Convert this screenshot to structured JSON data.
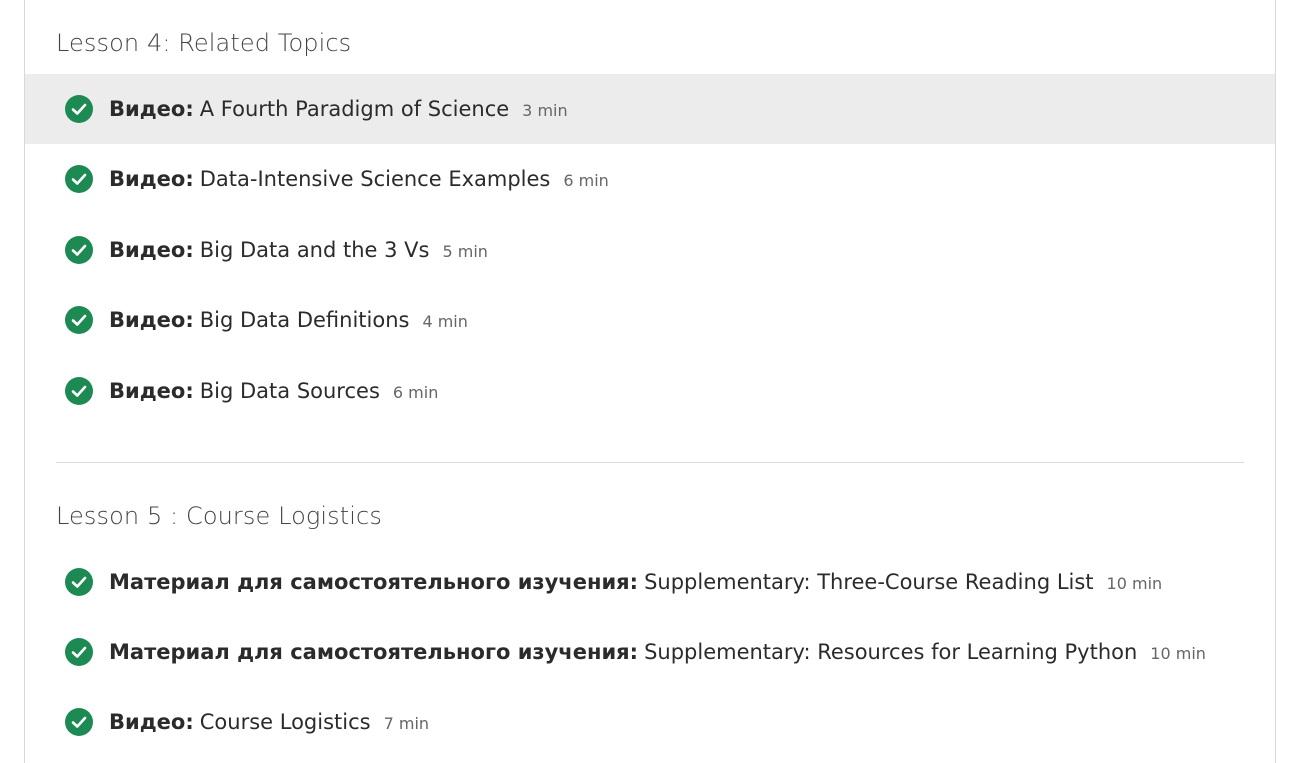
{
  "theme": {
    "check_color": "#1e8a53",
    "highlight_color": "#ececec",
    "border_color": "#d8d8d8"
  },
  "lesson4": {
    "title": "Lesson 4: Related Topics",
    "items": [
      {
        "type": "Видео:",
        "title": "A Fourth Paradigm of Science",
        "duration": "3 min",
        "completed": true
      },
      {
        "type": "Видео:",
        "title": "Data-Intensive Science Examples",
        "duration": "6 min",
        "completed": true
      },
      {
        "type": "Видео:",
        "title": "Big Data and the 3 Vs",
        "duration": "5 min",
        "completed": true
      },
      {
        "type": "Видео:",
        "title": "Big Data Definitions",
        "duration": "4 min",
        "completed": true
      },
      {
        "type": "Видео:",
        "title": "Big Data Sources",
        "duration": "6 min",
        "completed": true
      }
    ]
  },
  "lesson5": {
    "title": "Lesson 5 : Course Logistics",
    "items": [
      {
        "type": "Материал для самостоятельного изучения:",
        "title": "Supplementary: Three-Course Reading List",
        "duration": "10 min",
        "completed": true
      },
      {
        "type": "Материал для самостоятельного изучения:",
        "title": "Supplementary: Resources for Learning Python",
        "duration": "10 min",
        "completed": true
      },
      {
        "type": "Видео:",
        "title": "Course Logistics",
        "duration": "7 min",
        "completed": true
      }
    ]
  }
}
